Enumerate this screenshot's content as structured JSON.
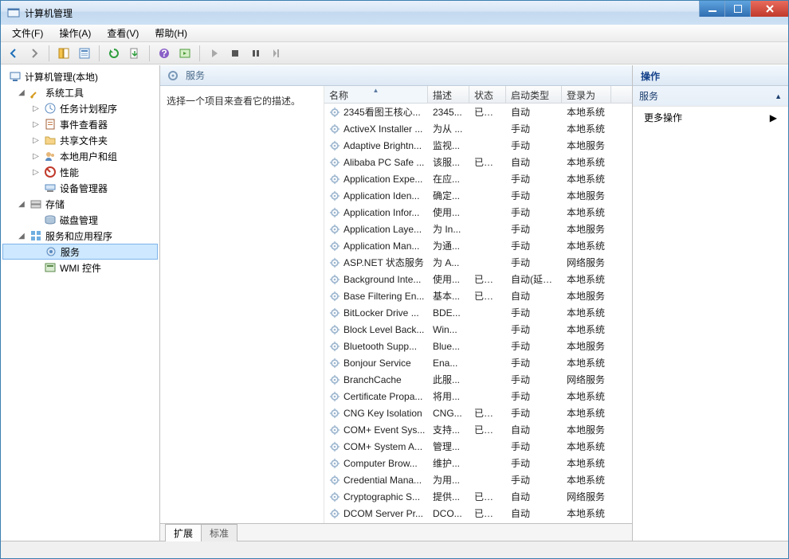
{
  "title": "计算机管理",
  "menu": {
    "file": "文件(F)",
    "action": "操作(A)",
    "view": "查看(V)",
    "help": "帮助(H)"
  },
  "tree": {
    "root": "计算机管理(本地)",
    "system_tools": "系统工具",
    "task_scheduler": "任务计划程序",
    "event_viewer": "事件查看器",
    "shared_folders": "共享文件夹",
    "local_users": "本地用户和组",
    "performance": "性能",
    "device_manager": "设备管理器",
    "storage": "存储",
    "disk_management": "磁盘管理",
    "services_apps": "服务和应用程序",
    "services": "服务",
    "wmi": "WMI 控件"
  },
  "center": {
    "header": "服务",
    "desc_prompt": "选择一个项目来查看它的描述。",
    "columns": {
      "name": "名称",
      "desc": "描述",
      "status": "状态",
      "start": "启动类型",
      "logon": "登录为"
    },
    "tabs": {
      "extended": "扩展",
      "standard": "标准"
    }
  },
  "actions": {
    "header": "操作",
    "section": "服务",
    "more": "更多操作"
  },
  "services": [
    {
      "name": "2345看图王核心...",
      "desc": "2345...",
      "status": "已启动",
      "start": "自动",
      "logon": "本地系统"
    },
    {
      "name": "ActiveX Installer ...",
      "desc": "为从 ...",
      "status": "",
      "start": "手动",
      "logon": "本地系统"
    },
    {
      "name": "Adaptive Brightn...",
      "desc": "监视...",
      "status": "",
      "start": "手动",
      "logon": "本地服务"
    },
    {
      "name": "Alibaba PC Safe ...",
      "desc": "该服...",
      "status": "已启动",
      "start": "自动",
      "logon": "本地系统"
    },
    {
      "name": "Application Expe...",
      "desc": "在应...",
      "status": "",
      "start": "手动",
      "logon": "本地系统"
    },
    {
      "name": "Application Iden...",
      "desc": "确定...",
      "status": "",
      "start": "手动",
      "logon": "本地服务"
    },
    {
      "name": "Application Infor...",
      "desc": "使用...",
      "status": "",
      "start": "手动",
      "logon": "本地系统"
    },
    {
      "name": "Application Laye...",
      "desc": "为 In...",
      "status": "",
      "start": "手动",
      "logon": "本地服务"
    },
    {
      "name": "Application Man...",
      "desc": "为通...",
      "status": "",
      "start": "手动",
      "logon": "本地系统"
    },
    {
      "name": "ASP.NET 状态服务",
      "desc": "为 A...",
      "status": "",
      "start": "手动",
      "logon": "网络服务"
    },
    {
      "name": "Background Inte...",
      "desc": "使用...",
      "status": "已启动",
      "start": "自动(延迟...",
      "logon": "本地系统"
    },
    {
      "name": "Base Filtering En...",
      "desc": "基本...",
      "status": "已启动",
      "start": "自动",
      "logon": "本地服务"
    },
    {
      "name": "BitLocker Drive ...",
      "desc": "BDE...",
      "status": "",
      "start": "手动",
      "logon": "本地系统"
    },
    {
      "name": "Block Level Back...",
      "desc": "Win...",
      "status": "",
      "start": "手动",
      "logon": "本地系统"
    },
    {
      "name": "Bluetooth Supp...",
      "desc": "Blue...",
      "status": "",
      "start": "手动",
      "logon": "本地服务"
    },
    {
      "name": "Bonjour Service",
      "desc": "Ena...",
      "status": "",
      "start": "手动",
      "logon": "本地系统"
    },
    {
      "name": "BranchCache",
      "desc": "此服...",
      "status": "",
      "start": "手动",
      "logon": "网络服务"
    },
    {
      "name": "Certificate Propa...",
      "desc": "将用...",
      "status": "",
      "start": "手动",
      "logon": "本地系统"
    },
    {
      "name": "CNG Key Isolation",
      "desc": "CNG...",
      "status": "已启动",
      "start": "手动",
      "logon": "本地系统"
    },
    {
      "name": "COM+ Event Sys...",
      "desc": "支持...",
      "status": "已启动",
      "start": "自动",
      "logon": "本地服务"
    },
    {
      "name": "COM+ System A...",
      "desc": "管理...",
      "status": "",
      "start": "手动",
      "logon": "本地系统"
    },
    {
      "name": "Computer Brow...",
      "desc": "维护...",
      "status": "",
      "start": "手动",
      "logon": "本地系统"
    },
    {
      "name": "Credential Mana...",
      "desc": "为用...",
      "status": "",
      "start": "手动",
      "logon": "本地系统"
    },
    {
      "name": "Cryptographic S...",
      "desc": "提供...",
      "status": "已启动",
      "start": "自动",
      "logon": "网络服务"
    },
    {
      "name": "DCOM Server Pr...",
      "desc": "DCO...",
      "status": "已启动",
      "start": "自动",
      "logon": "本地系统"
    }
  ]
}
